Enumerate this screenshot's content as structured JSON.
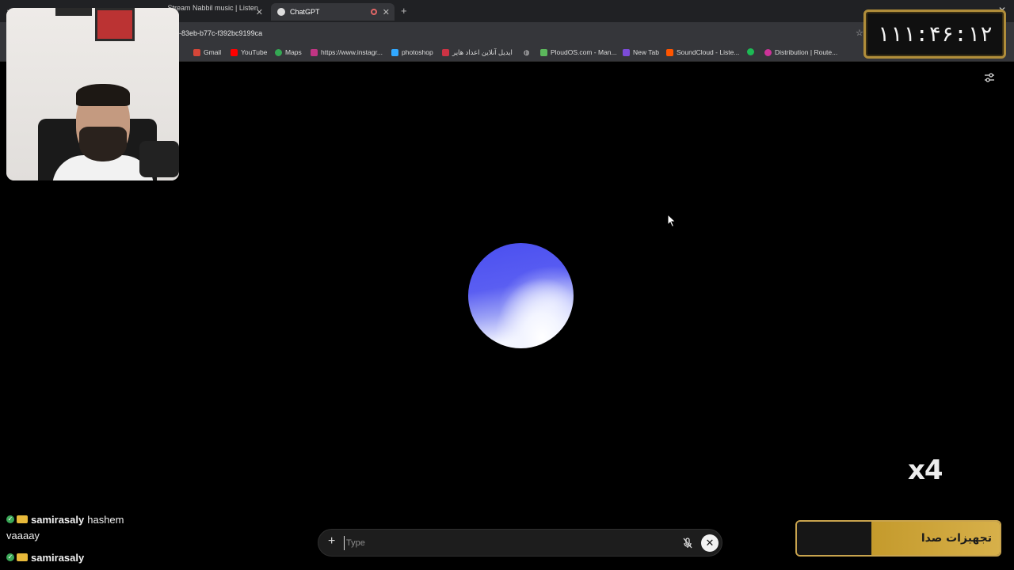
{
  "browser": {
    "tabs": [
      {
        "label": "Stream Nabbil music | Listen to",
        "active": false
      },
      {
        "label": "ChatGPT",
        "active": true
      }
    ],
    "url_fragment": "-83eb-b77c-f392bc9199ca",
    "bookmarks": [
      {
        "label": "Gmail",
        "icon": "gmail-icon",
        "color": "#d44638"
      },
      {
        "label": "YouTube",
        "icon": "youtube-icon",
        "color": "#ff0000"
      },
      {
        "label": "Maps",
        "icon": "maps-icon",
        "color": "#34a853"
      },
      {
        "label": "https://www.instagr...",
        "icon": "instagram-icon",
        "color": "#c13584"
      },
      {
        "label": "photoshop",
        "icon": "photoshop-icon",
        "color": "#31a8ff"
      },
      {
        "label": "ایدیل آنلاین اعداد هایر",
        "icon": "flag-icon",
        "color": "#cc3344"
      },
      {
        "label": "PloudOS.com - Man...",
        "icon": "ploudos-icon",
        "color": "#5cb85c"
      },
      {
        "label": "New Tab",
        "icon": "newtab-icon",
        "color": "#7b4bd8"
      },
      {
        "label": "SoundCloud - Liste...",
        "icon": "soundcloud-icon",
        "color": "#ff5500"
      },
      {
        "label": "Distribution | Route...",
        "icon": "distribution-icon",
        "color": "#cc3399"
      }
    ]
  },
  "timer": {
    "value": "۱۱۱:۴۶:۱۲"
  },
  "voice": {
    "orb_colors": [
      "#4a4ff0",
      "#f4f6ff"
    ]
  },
  "multiplier": "x4",
  "chat": [
    {
      "user": "samirasaly",
      "message": "hashem"
    },
    {
      "user": "",
      "message": "vaaaay"
    },
    {
      "user": "samirasaly",
      "message": ""
    }
  ],
  "input": {
    "placeholder": "Type"
  },
  "banner": {
    "text": "تجهیزات صدا",
    "accent": "#c9a44e"
  }
}
